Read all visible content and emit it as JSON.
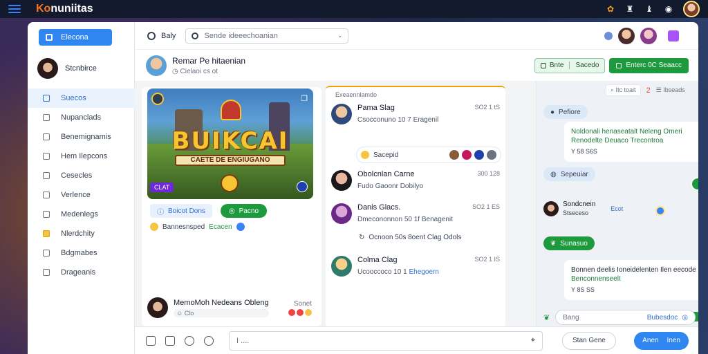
{
  "app": {
    "brand_k": "Ko",
    "brand_rest": "nuniitas"
  },
  "sidebar": {
    "primary_button": "Elecona",
    "profile_name": "Stcnbirce",
    "items": [
      {
        "label": "Suecos"
      },
      {
        "label": "Nupanclads"
      },
      {
        "label": "Benemignamis"
      },
      {
        "label": "Hem Ilepcons"
      },
      {
        "label": "Cesecles"
      },
      {
        "label": "Verlence"
      },
      {
        "label": "Medenlegs"
      },
      {
        "label": "Nlerdchity"
      },
      {
        "label": "Bdgmabes"
      },
      {
        "label": "Drageanis"
      }
    ]
  },
  "header": {
    "label": "Baly",
    "search_placeholder": "Sende ideeechoanian"
  },
  "subheader": {
    "title": "Remar Pe hitaenian",
    "subtitle": "Cielaoi cs ot",
    "pill_a": "Bnte",
    "pill_b": "Sacedo",
    "primary_action": "Enterc 0C Seaacc"
  },
  "post": {
    "image_title": "BUIKCAI",
    "image_subtitle": "CAETE DE ENGIUGANO",
    "image_tag": "CLAT",
    "button_a": "Boicot Dons",
    "button_b": "Pacno",
    "reaction_text": "Bannesnsped",
    "reaction_highlight": "Ecacen",
    "footer_user": "MemoMoh Nedeans",
    "footer_user_status": "Obleng",
    "footer_sub": "Clo",
    "footer_right": "Sonet"
  },
  "feed": {
    "heading": "Exeaennlamdo",
    "items": [
      {
        "name": "Pama Slag",
        "time": "SO2 1 tS",
        "desc": "Csocconuno 10 7 Eragenil",
        "desc_hl": ""
      },
      {
        "name": "Obolcnlan Carne",
        "time": "300 128",
        "desc": "Fudo Gaoonr Dobilyo",
        "desc_hl": ""
      },
      {
        "name": "Danis Glacs.",
        "time": "SO2 1 ES",
        "desc": "Dmecononnon 50 1f Benagenit",
        "desc_hl": ""
      },
      {
        "name": "Colma Clag",
        "time": "SO2 1 IS",
        "desc": "Ucooccoco 10 1",
        "desc_hl": "Ehegoern"
      }
    ],
    "chip": "Sacepid",
    "sub_line": "Ocnoon 50s 8oent Clag Odols"
  },
  "chat": {
    "top_search": "Itc toait",
    "top_count": "2",
    "top_box": "Ibseads",
    "label_1": "Pefiore",
    "bubble_1_main": "Noldonali henaseatalt Neleng Omeri",
    "bubble_1_sub": "Renodelte Deuaco Trecontroa",
    "bubble_1_meta": "Y 58 S6S",
    "label_2": "Sepeuiar",
    "online_name": "Sondcnein",
    "online_sub": "Stseceso",
    "online_link": "Ecot",
    "label_3": "Sunasuo",
    "bubble_2_main": "Bonnen deelis Ioneidelenten Ilen eecode",
    "bubble_2_sub": "Benconnenseelt",
    "bubble_2_meta": "Y 8S SS",
    "input_placeholder": "Bang",
    "input_action": "Bubesdoc"
  },
  "composer": {
    "input_value": "I ....",
    "secondary": "Stan Gene",
    "primary_a": "Anen",
    "primary_b": "Inen"
  }
}
